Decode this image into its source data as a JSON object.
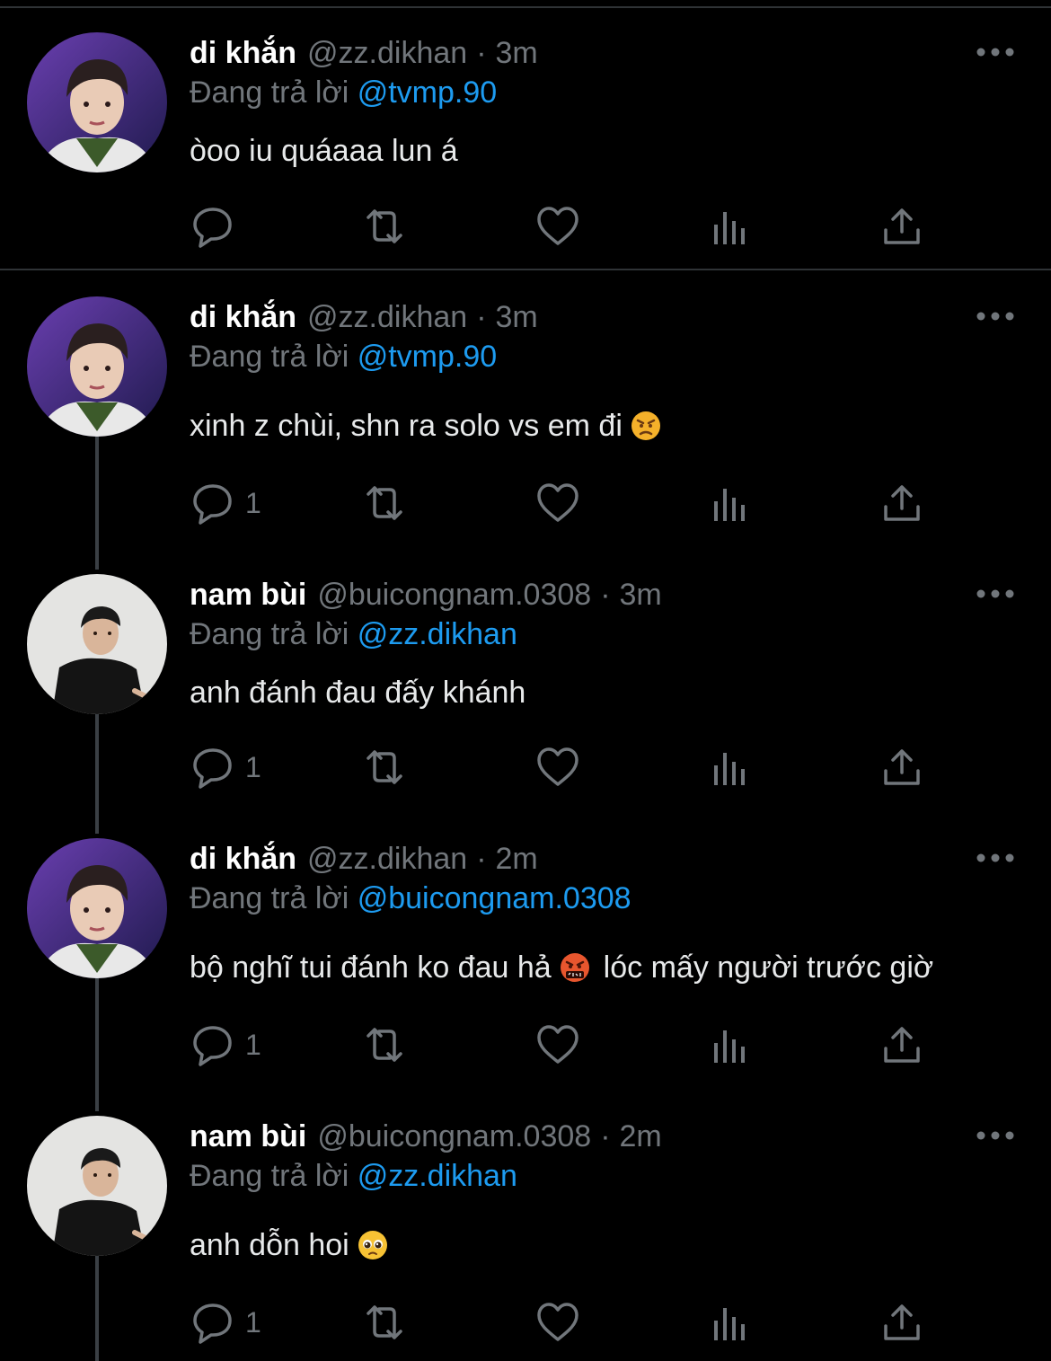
{
  "reply_prefix": "Đang trả lời",
  "colors": {
    "background": "#000000",
    "text": "#e7e9ea",
    "muted": "#71767b",
    "accent": "#1d9bf0",
    "separator": "#2f3336"
  },
  "tweets": [
    {
      "name": "di khắn",
      "handle": "@zz.dikhan",
      "time": "3m",
      "reply_to": "@tvmp.90",
      "text_before": "òoo iu quáaaa lun á",
      "emoji": "",
      "text_after": "",
      "reply_count": ""
    },
    {
      "name": "di khắn",
      "handle": "@zz.dikhan",
      "time": "3m",
      "reply_to": "@tvmp.90",
      "text_before": "xinh z chùi, shn ra solo vs em đi",
      "emoji": "angry-face",
      "text_after": "",
      "reply_count": "1"
    },
    {
      "name": "nam bùi",
      "handle": "@buicongnam.0308",
      "time": "3m",
      "reply_to": "@zz.dikhan",
      "text_before": "anh đánh đau đấy khánh",
      "emoji": "",
      "text_after": "",
      "reply_count": "1"
    },
    {
      "name": "di khắn",
      "handle": "@zz.dikhan",
      "time": "2m",
      "reply_to": "@buicongnam.0308",
      "text_before": "bộ nghĩ tui đánh ko đau hả",
      "emoji": "face-with-symbols-on-mouth",
      "text_after": "lóc mấy người trước giờ",
      "reply_count": "1"
    },
    {
      "name": "nam bùi",
      "handle": "@buicongnam.0308",
      "time": "2m",
      "reply_to": "@zz.dikhan",
      "text_before": "anh dỗn hoi",
      "emoji": "pleading-face",
      "text_after": "",
      "reply_count": "1"
    }
  ]
}
